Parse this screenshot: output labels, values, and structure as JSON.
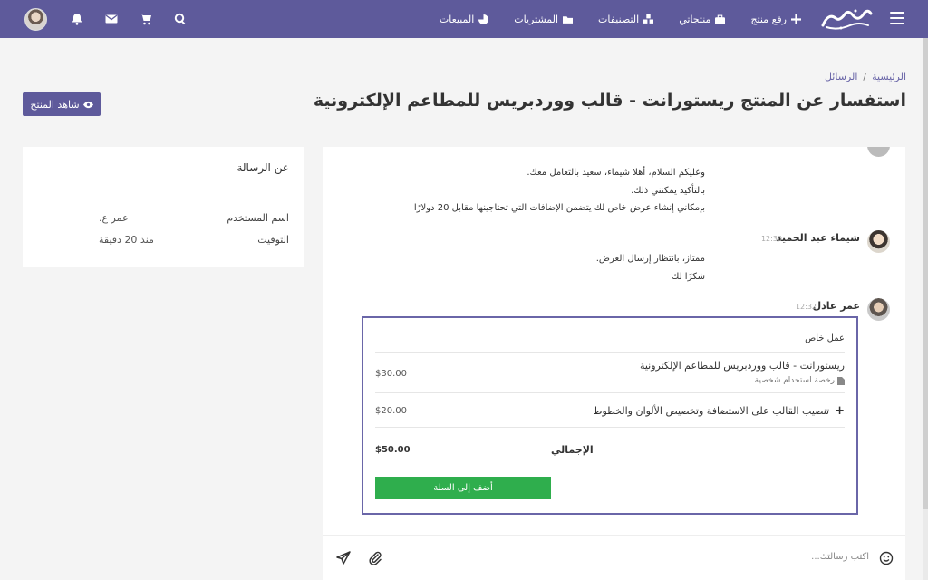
{
  "brand": {
    "accent": "#5e5a9b",
    "green": "#2fae4d"
  },
  "nav": {
    "links": [
      {
        "label": "رفع منتج",
        "icon": "plus-icon"
      },
      {
        "label": "منتجاتي",
        "icon": "briefcase-icon"
      },
      {
        "label": "التصنيفات",
        "icon": "cubes-icon"
      },
      {
        "label": "المشتريات",
        "icon": "folder-icon"
      },
      {
        "label": "المبيعات",
        "icon": "pie-chart-icon"
      }
    ],
    "icons": [
      "search-icon",
      "cart-icon",
      "envelope-icon",
      "bell-icon"
    ]
  },
  "breadcrumb": {
    "home": "الرئيسية",
    "separator": "/",
    "current": "الرسائل"
  },
  "page": {
    "title": "استفسار عن المنتج ريستورانت - قالب ووردبريس للمطاعم الإلكترونية",
    "view_button": "شاهد المنتج"
  },
  "info": {
    "title": "عن الرسالة",
    "rows": [
      {
        "label": "اسم المستخدم",
        "value": "عمر ع."
      },
      {
        "label": "التوقيت",
        "value": "منذ 20 دقيقة"
      }
    ]
  },
  "messages": [
    {
      "author": "",
      "time": "",
      "lines": [
        "وعليكم السلام، أهلا شيماء، سعيد بالتعامل معك.",
        "بالتأكيد يمكنني ذلك.",
        "بإمكاني إنشاء عرض خاص لك يتضمن الإضافات التي تحتاجينها مقابل 20 دولارًا"
      ]
    },
    {
      "author": "شيماء عبد الحميد",
      "time": "12:30",
      "lines": [
        "ممتاز، بانتظار إرسال العرض.",
        "شكرًا لك"
      ]
    },
    {
      "author": "عمر عادل",
      "time": "12:32",
      "lines": []
    }
  ],
  "offer": {
    "title": "عمل خاص",
    "product": "ريستورانت - قالب ووردبريس للمطاعم الإلكترونية",
    "license": "رخصة استخدام شخصية",
    "product_price": "$30.00",
    "addon": "تنصيب القالب على الاستضافة وتخصيص الألوان والخطوط",
    "addon_price": "$20.00",
    "total_label": "الإجمالي",
    "total": "$50.00",
    "cart_button": "أضف إلى السلة"
  },
  "composer": {
    "placeholder": "اكتب رسالتك..."
  }
}
